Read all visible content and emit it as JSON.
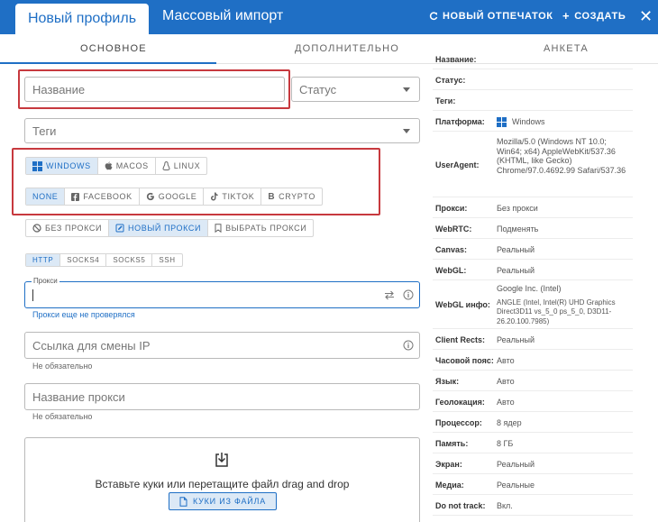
{
  "header": {
    "tab_profile": "Новый профиль",
    "tab_import": "Массовый импорт",
    "new_fingerprint": "НОВЫЙ ОТПЕЧАТОК",
    "create": "СОЗДАТЬ",
    "close": "✕"
  },
  "subtabs": [
    "ОСНОВНОЕ",
    "ДОПОЛНИТЕЛЬНО",
    "АНКЕТА"
  ],
  "form": {
    "name_placeholder": "Название",
    "status_placeholder": "Статус",
    "tags_placeholder": "Теги",
    "os_options": [
      "WINDOWS",
      "MACOS",
      "LINUX"
    ],
    "templates": [
      "NONE",
      "FACEBOOK",
      "GOOGLE",
      "TIKTOK",
      "CRYPTO"
    ],
    "proxy_modes": [
      "БЕЗ ПРОКСИ",
      "НОВЫЙ ПРОКСИ",
      "ВЫБРАТЬ ПРОКСИ"
    ],
    "proxy_types": [
      "HTTP",
      "SOCKS4",
      "SOCKS5",
      "SSH"
    ],
    "proxy_label": "Прокси",
    "proxy_hint": "Прокси еще не проверялся",
    "ip_link_placeholder": "Ссылка для смены IP",
    "ip_link_hint": "Не обязательно",
    "proxy_name_placeholder": "Название прокси",
    "proxy_name_hint": "Не обязательно",
    "dropzone_text": "Вставьте куки или перетащите файл drag and drop",
    "cookies_button": "КУКИ ИЗ ФАЙЛА"
  },
  "info": [
    {
      "label": "Название:",
      "value": ""
    },
    {
      "label": "Статус:",
      "value": ""
    },
    {
      "label": "Теги:",
      "value": ""
    },
    {
      "label": "Платформа:",
      "value": "Windows"
    },
    {
      "label": "UserAgent:",
      "value": "Mozilla/5.0 (Windows NT 10.0; Win64; x64) AppleWebKit/537.36 (KHTML, like Gecko) Chrome/97.0.4692.99 Safari/537.36"
    },
    {
      "label": "Прокси:",
      "value": "Без прокси"
    },
    {
      "label": "WebRTC:",
      "value": "Подменять"
    },
    {
      "label": "Canvas:",
      "value": "Реальный"
    },
    {
      "label": "WebGL:",
      "value": "Реальный"
    },
    {
      "label": "WebGL инфо:",
      "value": "Google Inc. (Intel)",
      "value2": "ANGLE (Intel, Intel(R) UHD Graphics Direct3D11 vs_5_0 ps_5_0, D3D11-26.20.100.7985)"
    },
    {
      "label": "Client Rects:",
      "value": "Реальный"
    },
    {
      "label": "Часовой пояс:",
      "value": "Авто"
    },
    {
      "label": "Язык:",
      "value": "Авто"
    },
    {
      "label": "Геолокация:",
      "value": "Авто"
    },
    {
      "label": "Процессор:",
      "value": "8 ядер"
    },
    {
      "label": "Память:",
      "value": "8 ГБ"
    },
    {
      "label": "Экран:",
      "value": "Реальный"
    },
    {
      "label": "Медиа:",
      "value": "Реальные"
    },
    {
      "label": "Do not track:",
      "value": "Вкл."
    }
  ],
  "colors": {
    "accent": "#1f6fc5",
    "highlight_box": "#c7393e"
  }
}
